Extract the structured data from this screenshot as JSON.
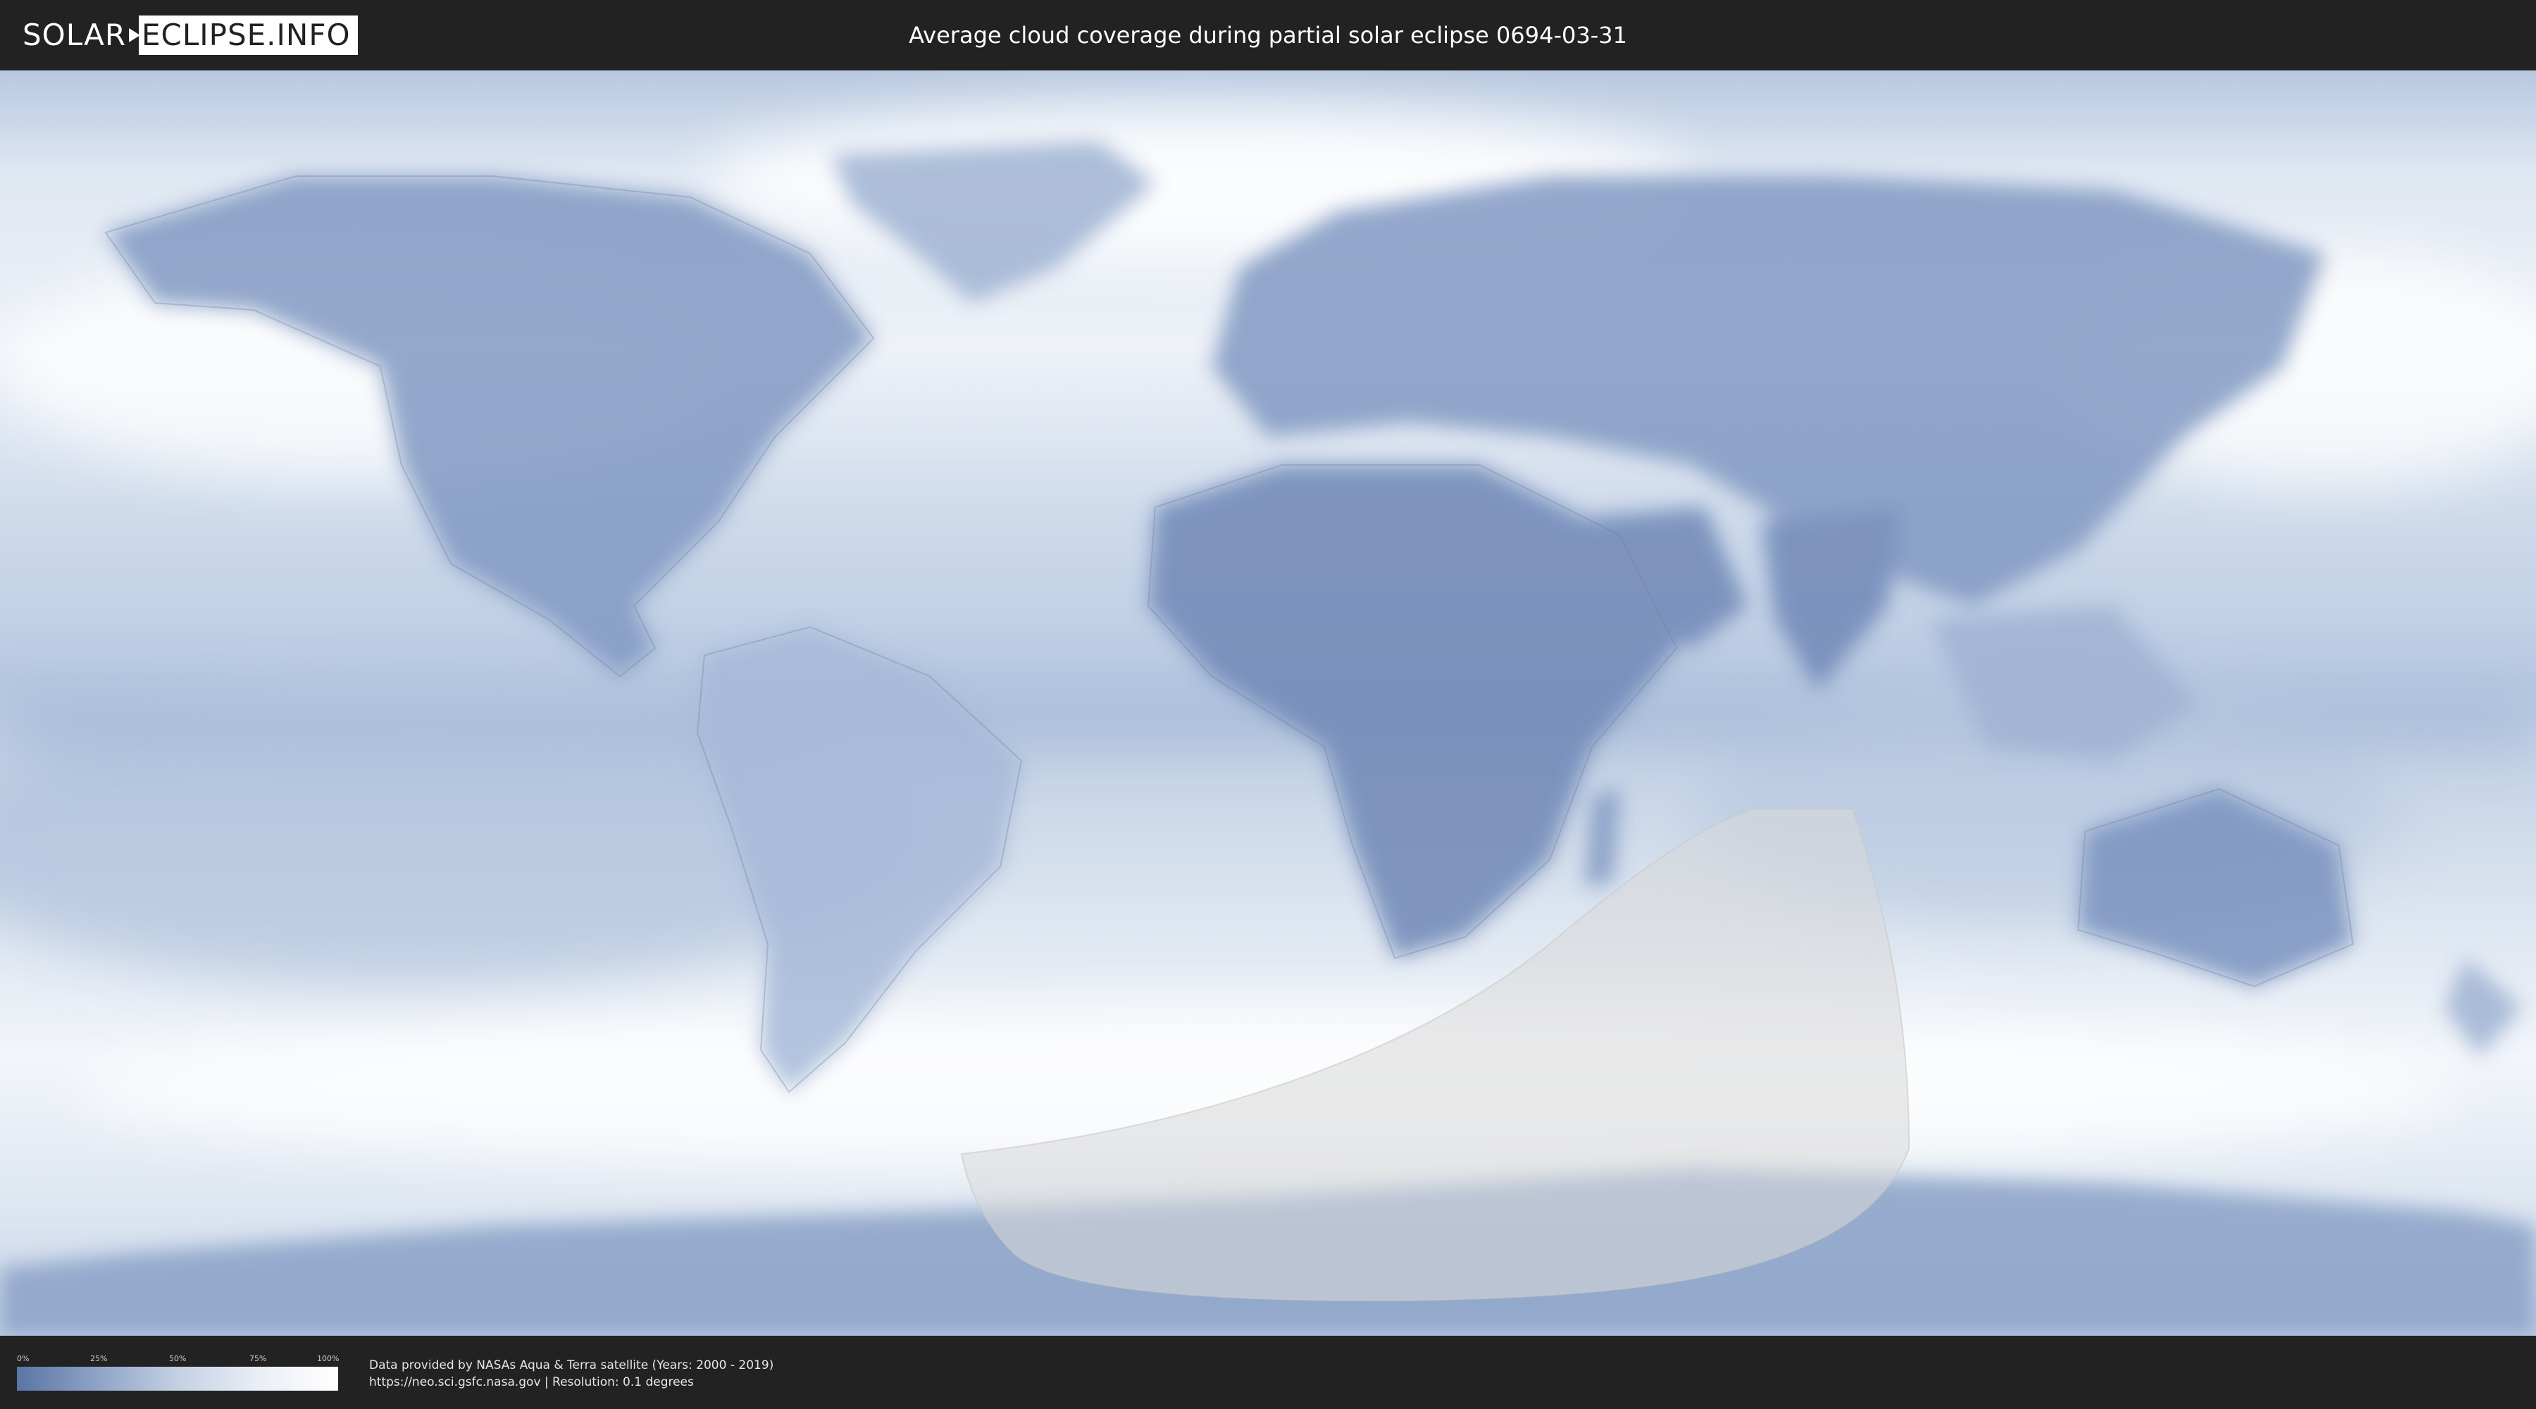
{
  "header": {
    "logo_left": "SOLAR",
    "logo_right": "ECLIPSE.INFO",
    "title": "Average cloud coverage during partial solar eclipse 0694-03-31"
  },
  "legend": {
    "ticks": [
      "0%",
      "25%",
      "50%",
      "75%",
      "100%"
    ],
    "colors": [
      "#5a75a5",
      "#8ea3c7",
      "#c4d0e3",
      "#e9eef6",
      "#ffffff"
    ]
  },
  "credits": {
    "line1": "Data provided by NASAs Aqua & Terra satellite (Years: 2000 - 2019)",
    "line2": "https://neo.sci.gsfc.nasa.gov | Resolution: 0.1 degrees"
  },
  "colors": {
    "background": "#222222",
    "ocean_cloud": "#dfe7f2",
    "land": "#7d95bf",
    "eclipse_zone": "#d9d9d9"
  }
}
